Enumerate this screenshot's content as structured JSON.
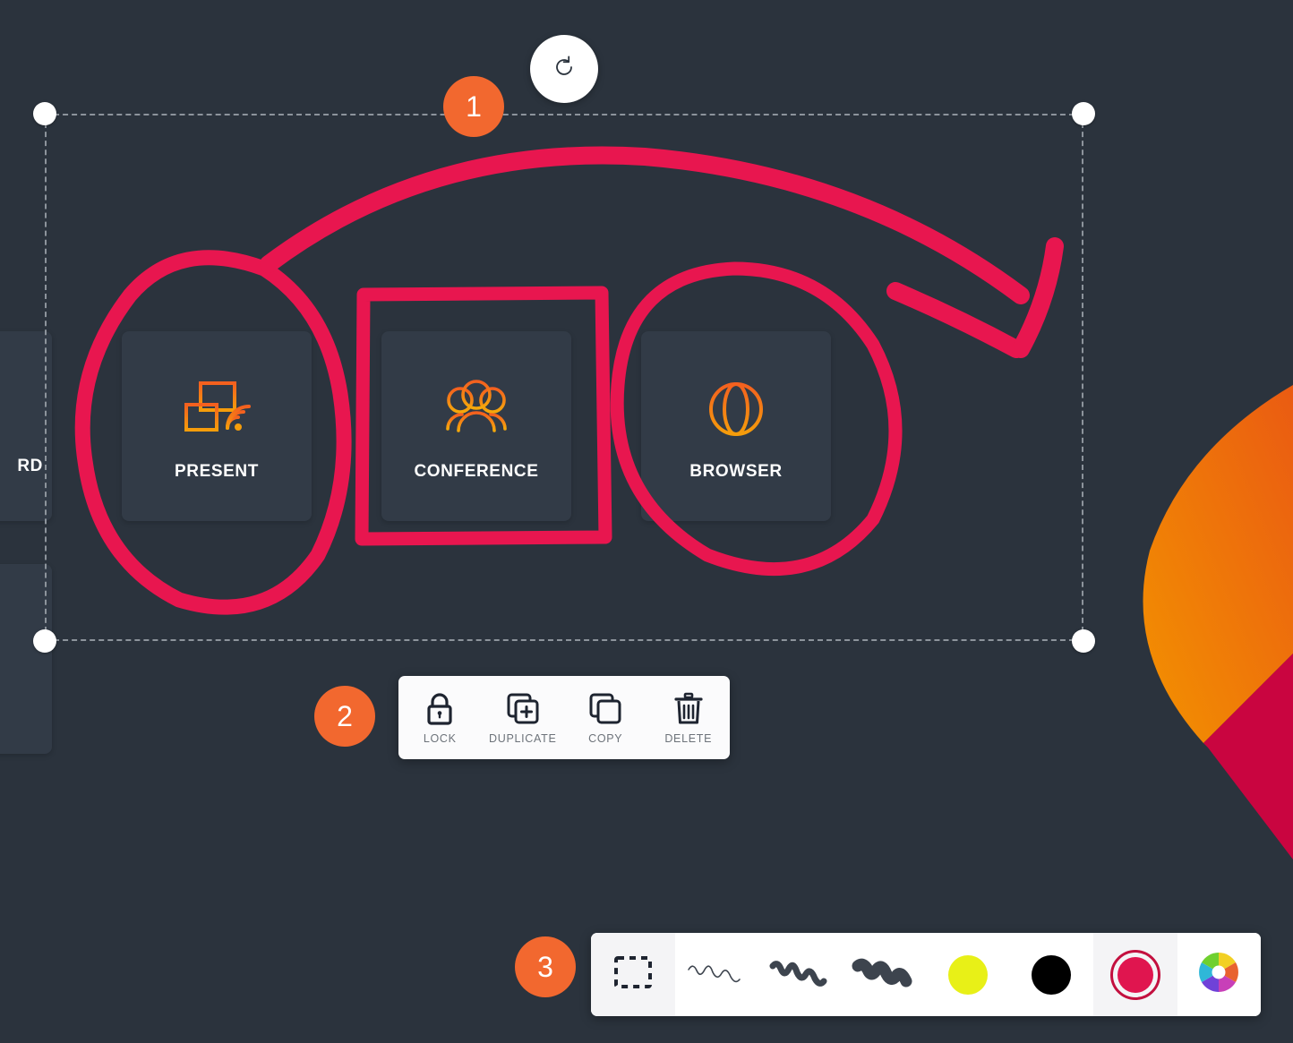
{
  "theme": {
    "canvas_bg": "#2b333d",
    "tile_bg": "#323b47",
    "accent_orange": "#f2682f",
    "ink_crimson": "#e8164f",
    "icon_orange_top": "#f4601f",
    "icon_orange_bottom": "#f59d0b",
    "selection_outline": "#8d949c"
  },
  "tiles": [
    {
      "id": "present",
      "label": "PRESENT",
      "icon": "screen-cast-icon"
    },
    {
      "id": "conference",
      "label": "CONFERENCE",
      "icon": "people-group-icon"
    },
    {
      "id": "browser",
      "label": "BROWSER",
      "icon": "globe-icon"
    }
  ],
  "offscreen_tiles": [
    {
      "id": "whiteboard-partial",
      "label": "RD"
    },
    {
      "id": "unlabeled-partial",
      "label": ""
    }
  ],
  "selection": {
    "rotate_handle_icon": "rotate-icon",
    "handles": [
      "top-left",
      "top-right",
      "bottom-left",
      "bottom-right"
    ]
  },
  "badges": [
    {
      "id": "badge-selection",
      "number": "1"
    },
    {
      "id": "badge-context-menu",
      "number": "2"
    },
    {
      "id": "badge-toolbar",
      "number": "3"
    }
  ],
  "context_menu": {
    "items": [
      {
        "id": "lock",
        "label": "LOCK",
        "icon": "lock-icon"
      },
      {
        "id": "duplicate",
        "label": "DUPLICATE",
        "icon": "duplicate-icon"
      },
      {
        "id": "copy",
        "label": "COPY",
        "icon": "copy-icon"
      },
      {
        "id": "delete",
        "label": "DELETE",
        "icon": "trash-icon"
      }
    ]
  },
  "toolbar": {
    "tools": [
      {
        "id": "select",
        "icon": "dashed-rectangle-select-icon",
        "active": true
      },
      {
        "id": "brush-thin",
        "icon": "stroke-thin-icon",
        "active": false
      },
      {
        "id": "brush-medium",
        "icon": "stroke-medium-icon",
        "active": false
      },
      {
        "id": "brush-thick",
        "icon": "stroke-thick-icon",
        "active": false
      }
    ],
    "colors": [
      {
        "id": "yellow",
        "swatch": "#e8f017",
        "selected": false
      },
      {
        "id": "black",
        "swatch": "#000000",
        "selected": false
      },
      {
        "id": "crimson",
        "swatch": "#e0154f",
        "selected": true
      },
      {
        "id": "custom",
        "swatch": "color-wheel-icon",
        "selected": false
      }
    ]
  },
  "annotations": [
    {
      "id": "ellipse-around-present",
      "shape": "ellipse",
      "color": "#e8164f"
    },
    {
      "id": "rectangle-around-conference",
      "shape": "rectangle",
      "color": "#e8164f"
    },
    {
      "id": "circle-around-browser",
      "shape": "circle",
      "color": "#e8164f"
    },
    {
      "id": "curved-arrow",
      "shape": "arrow",
      "color": "#e8164f"
    }
  ]
}
